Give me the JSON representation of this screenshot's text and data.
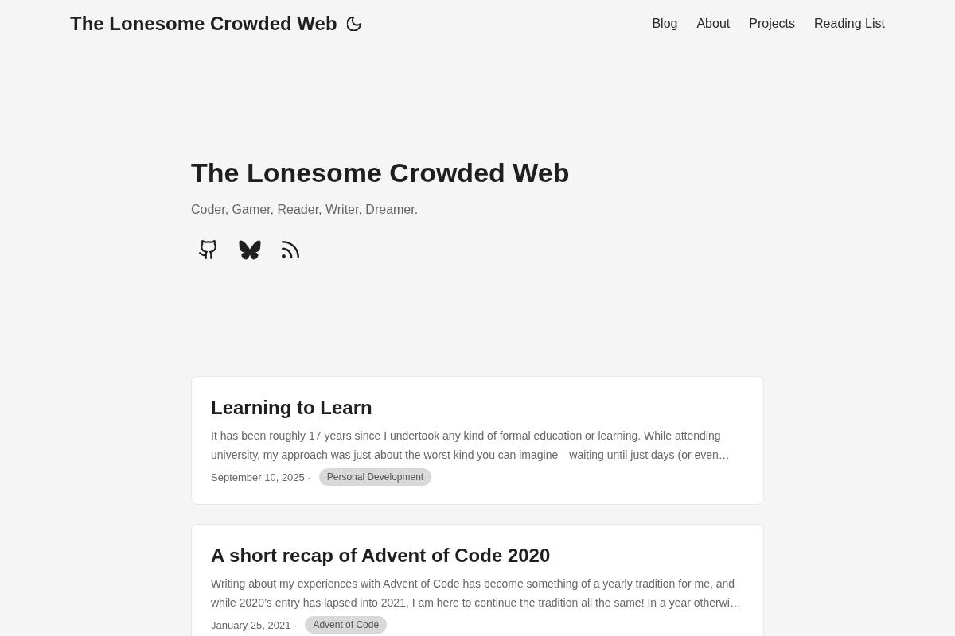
{
  "header": {
    "site_title": "The Lonesome Crowded Web",
    "nav": [
      {
        "label": "Blog"
      },
      {
        "label": "About"
      },
      {
        "label": "Projects"
      },
      {
        "label": "Reading List"
      }
    ]
  },
  "hero": {
    "title": "The Lonesome Crowded Web",
    "tagline": "Coder, Gamer, Reader, Writer, Dreamer."
  },
  "posts": [
    {
      "title": "Learning to Learn",
      "excerpt": "It has been roughly 17 years since I undertook any kind of formal education or learning. While attending university, my approach was just about the worst kind you can imagine—waiting until just days (or even…",
      "date": "September 10, 2025 ·",
      "tags": [
        "Personal Development"
      ]
    },
    {
      "title": "A short recap of Advent of Code 2020",
      "excerpt": "Writing about my experiences with Advent of Code has become something of a yearly tradition for me, and while 2020’s entry has lapsed into 2021, I am here to continue the tradition all the same! In a year otherwi…",
      "date": "January 25, 2021 ·",
      "tags": [
        "Advent of Code"
      ]
    }
  ]
}
